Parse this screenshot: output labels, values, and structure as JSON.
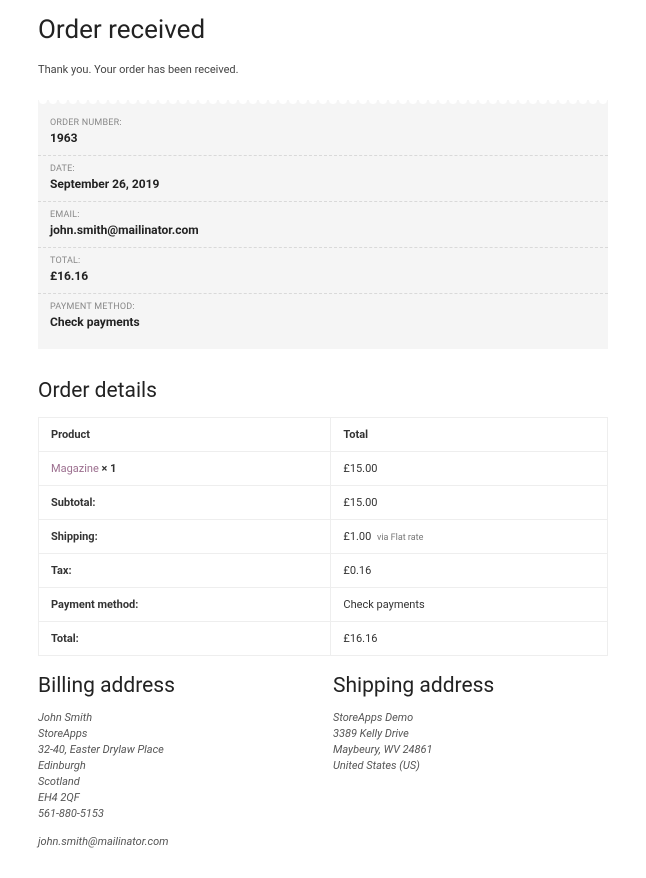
{
  "page_title": "Order received",
  "thankyou_text": "Thank you. Your order has been received.",
  "summary": {
    "order_number": {
      "label": "ORDER NUMBER:",
      "value": "1963"
    },
    "date": {
      "label": "DATE:",
      "value": "September 26, 2019"
    },
    "email": {
      "label": "EMAIL:",
      "value": "john.smith@mailinator.com"
    },
    "total": {
      "label": "TOTAL:",
      "value": "£16.16"
    },
    "payment": {
      "label": "PAYMENT METHOD:",
      "value": "Check payments"
    }
  },
  "order_details": {
    "heading": "Order details",
    "columns": {
      "product": "Product",
      "total": "Total"
    },
    "items": [
      {
        "name": "Magazine",
        "qty": "× 1",
        "total": "£15.00"
      }
    ],
    "rows": {
      "subtotal": {
        "label": "Subtotal:",
        "value": "£15.00"
      },
      "shipping": {
        "label": "Shipping:",
        "value": "£1.00",
        "note": "via Flat rate"
      },
      "tax": {
        "label": "Tax:",
        "value": "£0.16"
      },
      "payment": {
        "label": "Payment method:",
        "value": "Check payments"
      },
      "total": {
        "label": "Total:",
        "value": "£16.16"
      }
    }
  },
  "billing": {
    "heading": "Billing address",
    "lines": [
      "John Smith",
      "StoreApps",
      "32-40, Easter Drylaw Place",
      "Edinburgh",
      "Scotland",
      "EH4 2QF",
      "561-880-5153"
    ],
    "email": "john.smith@mailinator.com"
  },
  "shipping": {
    "heading": "Shipping address",
    "lines": [
      "StoreApps Demo",
      "3389 Kelly Drive",
      "Maybeury, WV 24861",
      "United States (US)"
    ]
  }
}
